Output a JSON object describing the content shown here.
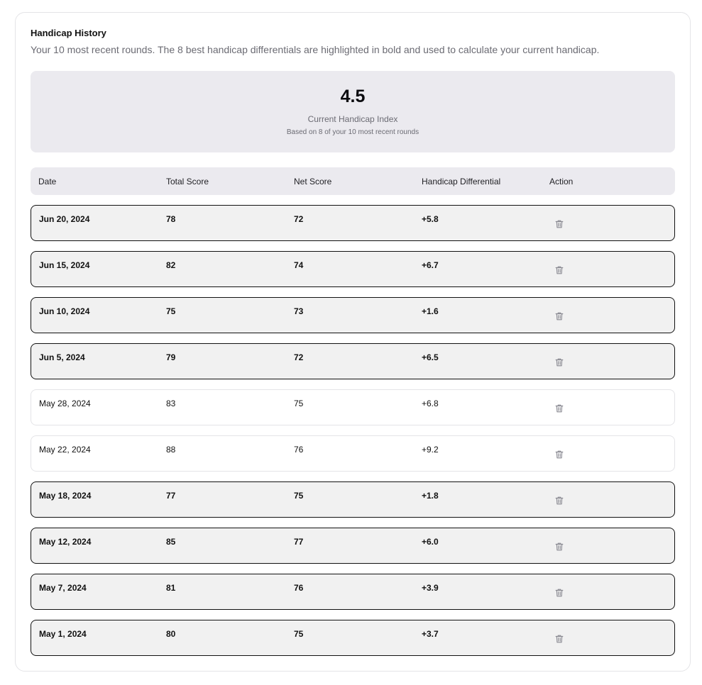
{
  "card": {
    "title": "Handicap History",
    "description": "Your 10 most recent rounds. The 8 best handicap differentials are highlighted in bold and used to calculate your current handicap."
  },
  "summary": {
    "value": "4.5",
    "label": "Current Handicap Index",
    "sublabel": "Based on 8 of your 10 most recent rounds"
  },
  "table": {
    "headers": [
      "Date",
      "Total Score",
      "Net Score",
      "Handicap Differential",
      "Action"
    ],
    "rows": [
      {
        "date": "Jun 20, 2024",
        "total": "78",
        "net": "72",
        "diff": "+5.8",
        "best": true,
        "action_icon": "trash-icon"
      },
      {
        "date": "Jun 15, 2024",
        "total": "82",
        "net": "74",
        "diff": "+6.7",
        "best": true,
        "action_icon": "trash-icon"
      },
      {
        "date": "Jun 10, 2024",
        "total": "75",
        "net": "73",
        "diff": "+1.6",
        "best": true,
        "action_icon": "trash-icon"
      },
      {
        "date": "Jun 5, 2024",
        "total": "79",
        "net": "72",
        "diff": "+6.5",
        "best": true,
        "action_icon": "trash-icon"
      },
      {
        "date": "May 28, 2024",
        "total": "83",
        "net": "75",
        "diff": "+6.8",
        "best": false,
        "action_icon": "trash-icon"
      },
      {
        "date": "May 22, 2024",
        "total": "88",
        "net": "76",
        "diff": "+9.2",
        "best": false,
        "action_icon": "trash-icon"
      },
      {
        "date": "May 18, 2024",
        "total": "77",
        "net": "75",
        "diff": "+1.8",
        "best": true,
        "action_icon": "trash-icon"
      },
      {
        "date": "May 12, 2024",
        "total": "85",
        "net": "77",
        "diff": "+6.0",
        "best": true,
        "action_icon": "trash-icon"
      },
      {
        "date": "May 7, 2024",
        "total": "81",
        "net": "76",
        "diff": "+3.9",
        "best": true,
        "action_icon": "trash-icon"
      },
      {
        "date": "May 1, 2024",
        "total": "80",
        "net": "75",
        "diff": "+3.7",
        "best": true,
        "action_icon": "trash-icon"
      }
    ]
  },
  "colors": {
    "best_row_bg": "#f1f1f1",
    "best_row_border": "#111111",
    "normal_row_border": "#e4e4e7",
    "summary_bg": "#ebeaef",
    "muted_text": "#6b6b73"
  }
}
